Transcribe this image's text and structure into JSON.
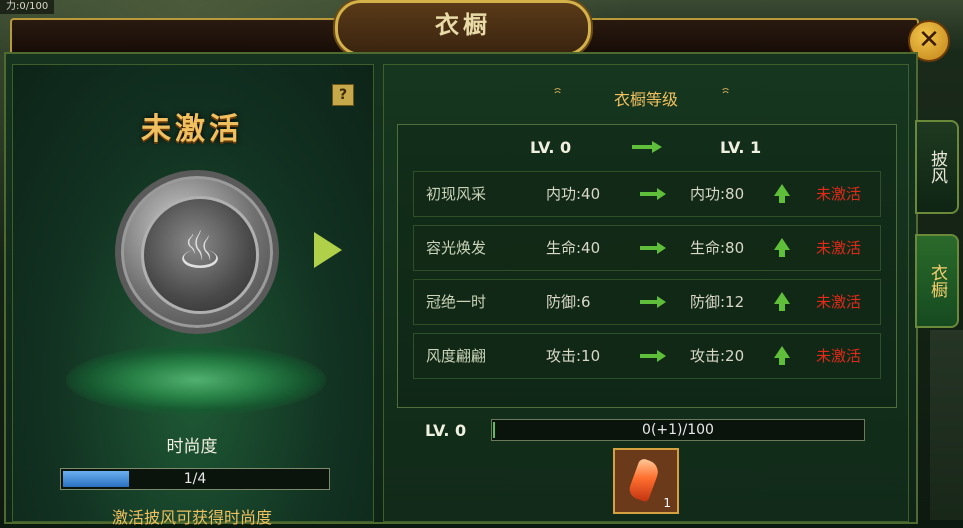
{
  "hud": {
    "top_stat": "力:0/100"
  },
  "window": {
    "title": "衣橱",
    "close_label": "✕"
  },
  "left": {
    "help_label": "?",
    "status_title": "未激活",
    "fashion_label": "时尚度",
    "progress": {
      "text": "1/4",
      "fraction": 0.25
    },
    "hint": "激活披风可获得时尚度"
  },
  "right": {
    "section_title": "衣橱等级",
    "header": {
      "current": "LV. 0",
      "next": "LV. 1"
    },
    "rows": [
      {
        "name": "初现风采",
        "current": "内功:40",
        "next": "内功:80",
        "status": "未激活"
      },
      {
        "name": "容光焕发",
        "current": "生命:40",
        "next": "生命:80",
        "status": "未激活"
      },
      {
        "name": "冠绝一时",
        "current": "防御:6",
        "next": "防御:12",
        "status": "未激活"
      },
      {
        "name": "风度翩翩",
        "current": "攻击:10",
        "next": "攻击:20",
        "status": "未激活"
      }
    ],
    "level_label": "LV. 0",
    "progress": {
      "text": "0(+1)/100",
      "fraction": 0.0
    },
    "item": {
      "count": "1"
    }
  },
  "tabs": [
    {
      "label": "披风",
      "active": false
    },
    {
      "label": "衣橱",
      "active": true
    }
  ],
  "colors": {
    "gold": "#f0c060",
    "inactive_red": "#e02a1a",
    "up_green": "#5fbf3a"
  }
}
